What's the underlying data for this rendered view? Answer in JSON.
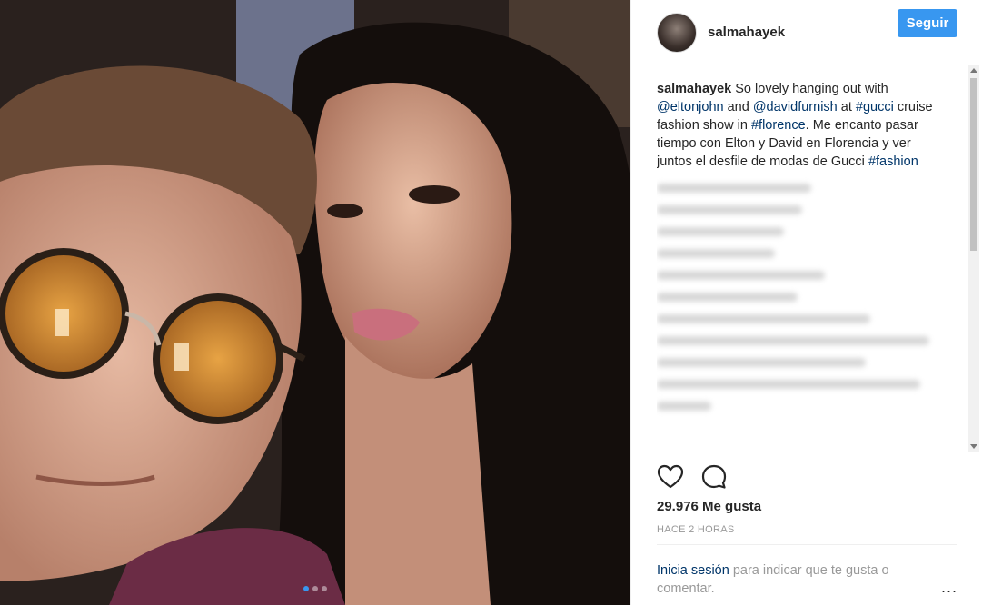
{
  "post": {
    "username": "salmahayek",
    "follow_label": "Seguir",
    "caption": {
      "user": "salmahayek",
      "parts": [
        {
          "text": " So lovely hanging out with ",
          "tag": false
        },
        {
          "text": "@eltonjohn",
          "tag": true
        },
        {
          "text": " and ",
          "tag": false
        },
        {
          "text": "@davidfurnish",
          "tag": true
        },
        {
          "text": " at ",
          "tag": false
        },
        {
          "text": "#gucci",
          "tag": true
        },
        {
          "text": " cruise fashion show in ",
          "tag": false
        },
        {
          "text": "#florence",
          "tag": true
        },
        {
          "text": ". Me encanto pasar tiempo con Elton y David en Florencia y ver juntos el desfile de modas de Gucci ",
          "tag": false
        },
        {
          "text": "#fashion",
          "tag": true
        }
      ]
    },
    "likes": "29.976 Me gusta",
    "time": "HACE 2 HORAS",
    "footer": {
      "link": "Inicia sesión",
      "rest": " para indicar que te gusta o comentar.",
      "more": "..."
    },
    "carousel": {
      "count": 3,
      "active": 0
    }
  },
  "colors": {
    "accent": "#3897f0",
    "link": "#003569",
    "muted": "#999999"
  },
  "icons": [
    "heart-icon",
    "comment-icon",
    "more-options-icon"
  ]
}
